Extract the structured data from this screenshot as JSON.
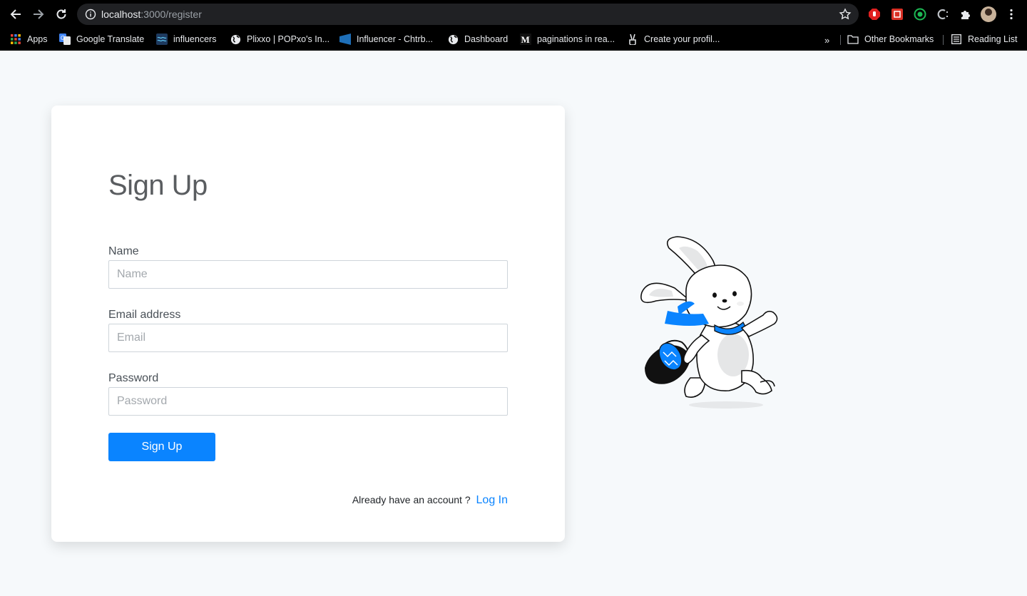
{
  "browser": {
    "url_host": "localhost",
    "url_path": ":3000/register",
    "bookmarks": [
      {
        "label": "Apps",
        "icon": "apps-grid-icon"
      },
      {
        "label": "Google Translate",
        "icon": "google-translate-icon"
      },
      {
        "label": "influencers",
        "icon": "influencers-icon"
      },
      {
        "label": "Plixxo | POPxo's In...",
        "icon": "globe-icon"
      },
      {
        "label": "Influencer - Chtrb...",
        "icon": "chtrbox-icon"
      },
      {
        "label": "Dashboard",
        "icon": "globe-icon"
      },
      {
        "label": "paginations in rea...",
        "icon": "medium-icon"
      },
      {
        "label": "Create your profil...",
        "icon": "peace-hand-icon"
      }
    ],
    "overflow_label": "»",
    "other_bookmarks": "Other Bookmarks",
    "reading_list": "Reading List"
  },
  "form": {
    "title": "Sign Up",
    "name_label": "Name",
    "name_placeholder": "Name",
    "email_label": "Email address",
    "email_placeholder": "Email",
    "password_label": "Password",
    "password_placeholder": "Password",
    "submit_label": "Sign Up",
    "footer_text": "Already have an account ?",
    "login_link": "Log In"
  },
  "colors": {
    "accent": "#0a84ff",
    "page_bg": "#f6f9fb",
    "card_bg": "#ffffff"
  }
}
